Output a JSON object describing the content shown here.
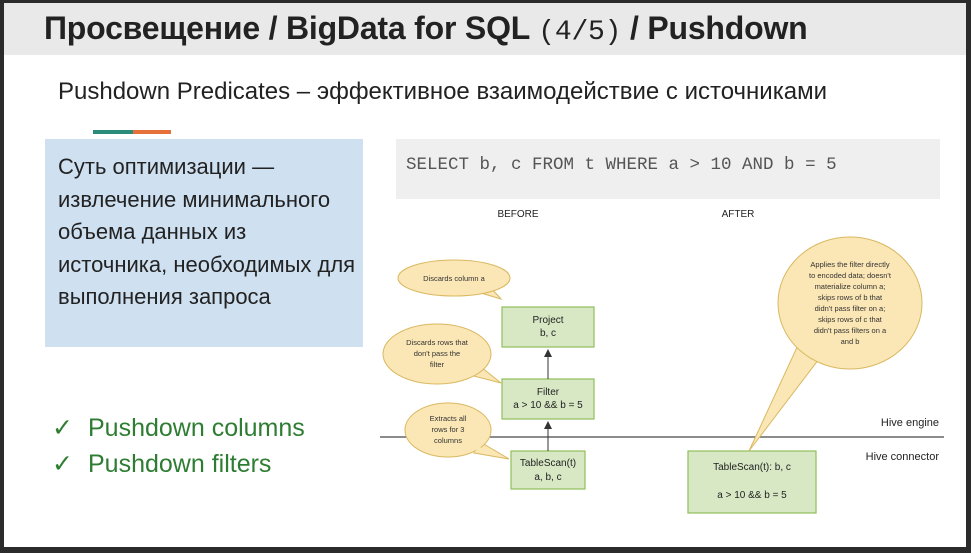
{
  "title": {
    "main": "Просвещение / BigData for SQL ",
    "part": "(4/5)",
    "tail": " / Pushdown"
  },
  "subtitle": "Pushdown Predicates – эффективное взаимодействие с источниками",
  "essence": "Суть оптимизации — извлечение минимального объема данных из источника, необходимых для выполнения запроса",
  "checklist": [
    {
      "mark": "✓",
      "label": "Pushdown columns"
    },
    {
      "mark": "✓",
      "label": "Pushdown filters"
    }
  ],
  "sql": "SELECT b, c FROM t WHERE a > 10 AND b = 5",
  "diagram": {
    "before_label": "BEFORE",
    "after_label": "AFTER",
    "hive_engine": "Hive engine",
    "hive_connector": "Hive connector",
    "project": {
      "title": "Project",
      "sub": "b, c"
    },
    "filter": {
      "title": "Filter",
      "sub": "a > 10 && b = 5"
    },
    "tablescan": {
      "title": "TableScan(t)",
      "sub": "a, b, c"
    },
    "after_scan": {
      "title": "TableScan(t): b, c",
      "sub": "a > 10 && b = 5"
    },
    "bubble_discards_column": "Discards column a",
    "bubble_discards_rows": [
      "Discards rows that",
      "don't pass the",
      "filter"
    ],
    "bubble_extracts": [
      "Extracts all",
      "rows for 3",
      "columns"
    ],
    "bubble_applies": [
      "Applies the filter directly",
      "to encoded data; doesn't",
      "materialize column a;",
      "skips rows of b that",
      "didn't pass filter on a;",
      "skips rows of c that",
      "didn't pass filters on a",
      "and b"
    ]
  },
  "colors": {
    "box_fill": "#d8e8c4",
    "box_stroke": "#8fbf5a",
    "bubble_fill": "#fbe7b5",
    "bubble_stroke": "#d9b860",
    "essence_bg": "#cfe0f1",
    "check_green": "#2e7d32",
    "accent_teal": "#2c8c7b",
    "accent_orange": "#e5703a"
  }
}
